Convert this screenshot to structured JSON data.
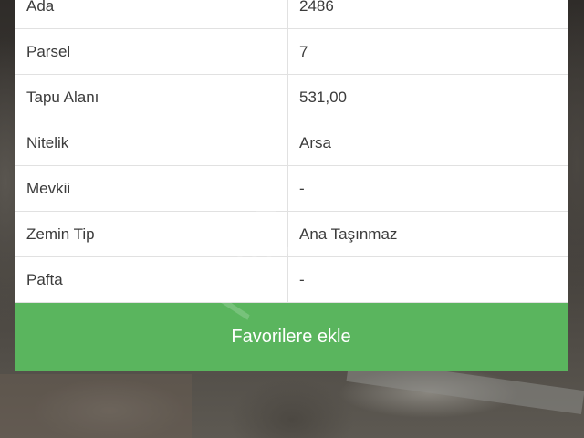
{
  "details": {
    "rows": [
      {
        "label": "Ada",
        "value": "2486"
      },
      {
        "label": "Parsel",
        "value": "7"
      },
      {
        "label": "Tapu Alanı",
        "value": "531,00"
      },
      {
        "label": "Nitelik",
        "value": "Arsa"
      },
      {
        "label": "Mevkii",
        "value": "-"
      },
      {
        "label": "Zemin Tip",
        "value": "Ana Taşınmaz"
      },
      {
        "label": "Pafta",
        "value": "-"
      }
    ]
  },
  "actions": {
    "favorite_label": "Favorilere ekle"
  },
  "theme": {
    "button_color": "#5ab55e"
  }
}
